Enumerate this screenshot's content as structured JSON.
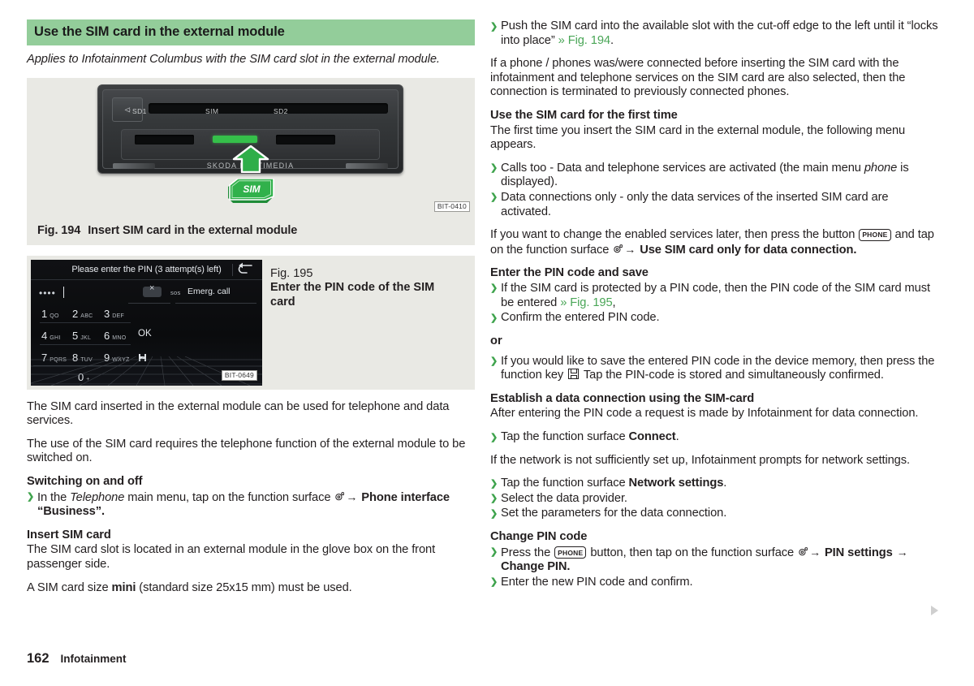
{
  "document": {
    "page_number": "162",
    "section": "Infotainment"
  },
  "left_column": {
    "section_heading": "Use the SIM card in the external module",
    "applies_to": "Applies to Infotainment Columbus with the SIM card slot in the external module.",
    "fig194": {
      "caption_number": "Fig. 194",
      "caption_text": "Insert SIM card in the external module",
      "image_code": "BIT-0410",
      "slot_labels": [
        "SD1",
        "SIM",
        "SD2"
      ],
      "brand_text": "SKODA MULTIMEDIA",
      "card_badge": "SIM",
      "eject_symbol": "⏏"
    },
    "fig195": {
      "caption_number": "Fig. 195",
      "caption_text": "Enter the PIN code of the SIM card",
      "image_code": "BIT-0649",
      "screen": {
        "title": "Please enter the PIN (3 attempt(s) left)",
        "pin_value": "••••",
        "sos_label": "sos",
        "emergency_call": "Emerg. call",
        "keys": [
          {
            "num": "1",
            "letters": "QO"
          },
          {
            "num": "2",
            "letters": "ABC"
          },
          {
            "num": "3",
            "letters": "DEF"
          },
          {
            "num": "4",
            "letters": "GHI"
          },
          {
            "num": "5",
            "letters": "JKL"
          },
          {
            "num": "6",
            "letters": "MNO"
          },
          {
            "num": "7",
            "letters": "PQRS"
          },
          {
            "num": "8",
            "letters": "TUV"
          },
          {
            "num": "9",
            "letters": "WXYZ"
          },
          {
            "num": "0",
            "letters": "+"
          }
        ],
        "ok_label": "OK"
      }
    },
    "para_1": "The SIM card inserted in the external module can be used for telephone and data services.",
    "para_2": "The use of the SIM card requires the telephone function of the external module to be switched on.",
    "heading_switching": "Switching on and off",
    "switching_bullet_pre": "In the ",
    "switching_bullet_italic": "Telephone",
    "switching_bullet_mid": " main menu, tap on the function surface ",
    "switching_bullet_target": "Phone interface “Business”.",
    "heading_insert": "Insert SIM card",
    "para_3": "The SIM card slot is located in an external module in the glove box on the front passenger side.",
    "para_4_pre": "A SIM card size ",
    "para_4_bold": "mini",
    "para_4_post": " (standard size 25x15 mm) must be used."
  },
  "right_column": {
    "bullet_push_pre": "Push the SIM card into the available slot with the cut-off edge to the left until it “locks into place” ",
    "bullet_push_xref": "» Fig. 194",
    "bullet_push_post": ".",
    "para_phones": "If a phone / phones was/were connected before inserting the SIM card with the infotainment and telephone services on the SIM card are also selected, then the connection is terminated to previously connected phones.",
    "heading_first_time": "Use the SIM card for the first time",
    "para_first_time": "The first time you insert the SIM card in the external module, the following menu appears.",
    "bullet_calls_pre": "Calls too - Data and telephone services are activated (the main menu ",
    "bullet_calls_italic": "phone",
    "bullet_calls_post": " is displayed).",
    "bullet_data_only": "Data connections only - only the data services of the inserted SIM card are activated.",
    "para_change_pre": "If you want to change the enabled services later, then press the button ",
    "para_change_key": "PHONE",
    "para_change_mid": " and tap on the function surface ",
    "para_change_target": "Use SIM card only for data connection.",
    "heading_enter_pin": "Enter the PIN code and save",
    "bullet_protected_pre": "If the SIM card is protected by a PIN code, then the PIN code of the SIM card must be entered ",
    "bullet_protected_xref": "» Fig. 195",
    "bullet_protected_post": ",",
    "bullet_confirm": "Confirm the entered PIN code.",
    "or_label": "or",
    "bullet_save_pre": "If you would like to save the entered PIN code in the device memory, then press the function key ",
    "bullet_save_post": " Tap the PIN-code is stored and simultaneously confirmed.",
    "heading_establish": "Establish a data connection using the SIM-card",
    "para_establish": "After entering the PIN code a request is made by Infotainment for data connection.",
    "bullet_connect_pre": "Tap the function surface ",
    "bullet_connect_bold": "Connect",
    "bullet_connect_post": ".",
    "para_network": "If the network is not sufficiently set up, Infotainment prompts for network settings.",
    "bullet_netsettings_pre": "Tap the function surface ",
    "bullet_netsettings_bold": "Network settings",
    "bullet_netsettings_post": ".",
    "bullet_provider": "Select the data provider.",
    "bullet_params": "Set the parameters for the data connection.",
    "heading_change_pin": "Change PIN code",
    "bullet_press_pre": "Press the ",
    "bullet_press_key": "PHONE",
    "bullet_press_mid": " button, then tap on the function surface ",
    "bullet_press_target_1": "PIN settings",
    "bullet_press_target_2": "Change PIN.",
    "bullet_newpin": "Enter the new PIN code and confirm."
  },
  "colors": {
    "heading_green": "#93cd9a",
    "xref_green": "#4aa657",
    "bullet_green": "#3fa34d",
    "figure_bg": "#e9e9e4",
    "sim_green": "#2fae49"
  }
}
